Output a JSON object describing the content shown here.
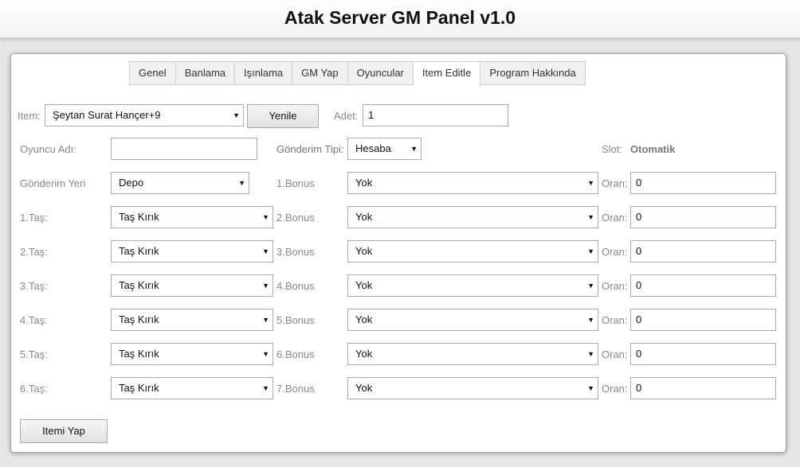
{
  "header": {
    "title": "Atak Server GM Panel v1.0"
  },
  "tabs": [
    {
      "label": "Genel",
      "active": false
    },
    {
      "label": "Banlama",
      "active": false
    },
    {
      "label": "Işınlama",
      "active": false
    },
    {
      "label": "GM Yap",
      "active": false
    },
    {
      "label": "Oyuncular",
      "active": false
    },
    {
      "label": "Item Editle",
      "active": true
    },
    {
      "label": "Program Hakkında",
      "active": false
    }
  ],
  "form": {
    "item_label": "Item:",
    "item_value": "Şeytan Surat Hançer+9",
    "refresh_label": "Yenile",
    "adet_label": "Adet:",
    "adet_value": "1",
    "player_label": "Oyuncu Adı:",
    "player_value": "",
    "send_type_label": "Gönderim Tipi:",
    "send_type_value": "Hesaba",
    "slot_label": "Slot:",
    "slot_value": "Otomatik",
    "dest_label": "Gönderim Yeri",
    "dest_value": "Depo",
    "oran_label": "Oran:",
    "submit_label": "Itemi Yap",
    "stones": [
      {
        "label": "1.Taş:",
        "value": "Taş Kırık"
      },
      {
        "label": "2.Taş:",
        "value": "Taş Kırık"
      },
      {
        "label": "3.Taş:",
        "value": "Taş Kırık"
      },
      {
        "label": "4.Taş:",
        "value": "Taş Kırık"
      },
      {
        "label": "5.Taş:",
        "value": "Taş Kırık"
      },
      {
        "label": "6.Taş:",
        "value": "Taş Kırık"
      }
    ],
    "bonuses": [
      {
        "label": "1.Bonus",
        "value": "Yok",
        "oran": "0"
      },
      {
        "label": "2.Bonus",
        "value": "Yok",
        "oran": "0"
      },
      {
        "label": "3.Bonus",
        "value": "Yok",
        "oran": "0"
      },
      {
        "label": "4.Bonus",
        "value": "Yok",
        "oran": "0"
      },
      {
        "label": "5.Bonus",
        "value": "Yok",
        "oran": "0"
      },
      {
        "label": "6.Bonus",
        "value": "Yok",
        "oran": "0"
      },
      {
        "label": "7.Bonus",
        "value": "Yok",
        "oran": "0"
      }
    ]
  }
}
